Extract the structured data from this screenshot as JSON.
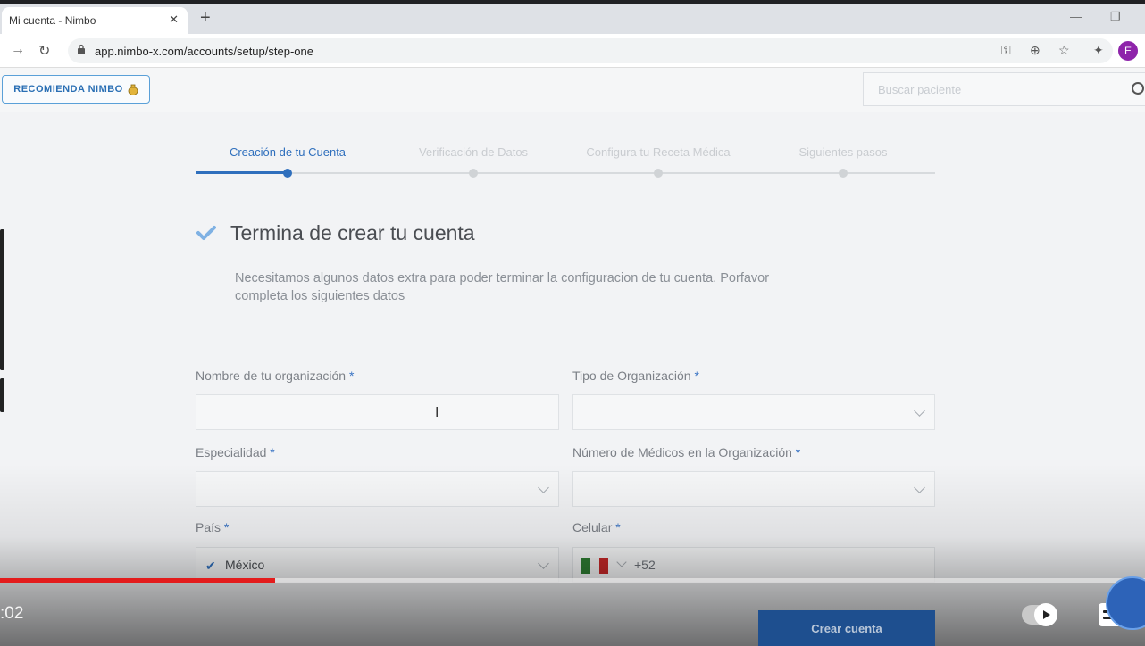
{
  "browser": {
    "tab_title": "Mi cuenta - Nimbo",
    "url": "app.nimbo-x.com/accounts/setup/step-one",
    "profile_initial": "E"
  },
  "header": {
    "recommend_label": "RECOMIENDA NIMBO",
    "search_placeholder": "Buscar paciente"
  },
  "stepper": {
    "steps": [
      {
        "label": "Creación de tu Cuenta",
        "active": true
      },
      {
        "label": "Verificación de Datos",
        "active": false
      },
      {
        "label": "Configura tu Receta Médica",
        "active": false
      },
      {
        "label": "Siguientes pasos",
        "active": false
      }
    ]
  },
  "content": {
    "title": "Termina de crear tu cuenta",
    "description": "Necesitamos algunos datos extra para poder terminar la configuracion de tu cuenta. Porfavor completa los siguientes datos"
  },
  "form": {
    "org_name_label": "Nombre de tu organización",
    "org_type_label": "Tipo de Organización",
    "specialty_label": "Especialidad",
    "doctors_label": "Número de Médicos en la Organización",
    "country_label": "País",
    "country_value": "México",
    "phone_label": "Celular",
    "phone_code": "+52",
    "required_mark": "*",
    "submit_label": "Crear cuenta"
  },
  "video": {
    "time": ":02",
    "progress": 0.24
  },
  "colors": {
    "accent": "#2f6fbd",
    "progress": "#e31c1c",
    "button": "#1e4f8f"
  }
}
